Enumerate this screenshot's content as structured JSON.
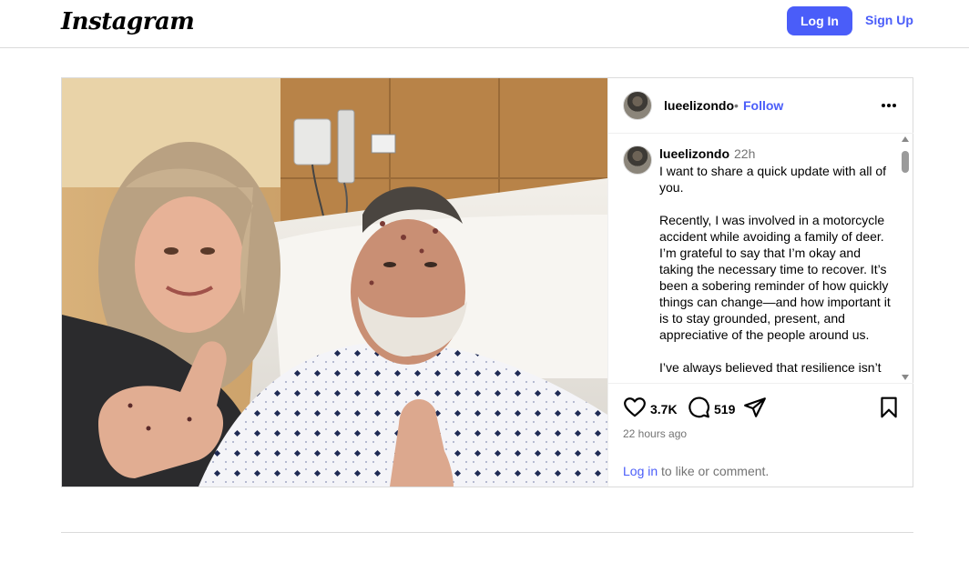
{
  "header": {
    "logo_text": "Instagram",
    "login_label": "Log In",
    "signup_label": "Sign Up"
  },
  "post": {
    "username": "lueelizondo",
    "follow_separator": "•",
    "follow_label": "Follow",
    "caption": {
      "username": "lueelizondo",
      "time": "22h",
      "text": "I want to share a quick update with all of you.\n\nRecently, I was involved in a motorcycle accident while avoiding a family of deer. I’m grateful to say that I’m okay and taking the necessary time to recover. It’s been a sobering reminder of how quickly things can change—and how important it is to stay grounded, present, and appreciative of the people around us.\n\nI’ve always believed that resilience isn’t"
    },
    "likes": "3.7K",
    "comments": "519",
    "timestamp": "22 hours ago",
    "login_link": "Log in",
    "login_suffix": " to like or comment."
  },
  "icons": {
    "more": "more-options-icon",
    "like": "heart-icon",
    "comment": "comment-icon",
    "share": "share-icon",
    "save": "bookmark-icon"
  },
  "colors": {
    "accent": "#4a5df9",
    "muted_text": "#737373",
    "border": "#dbdbdb"
  }
}
